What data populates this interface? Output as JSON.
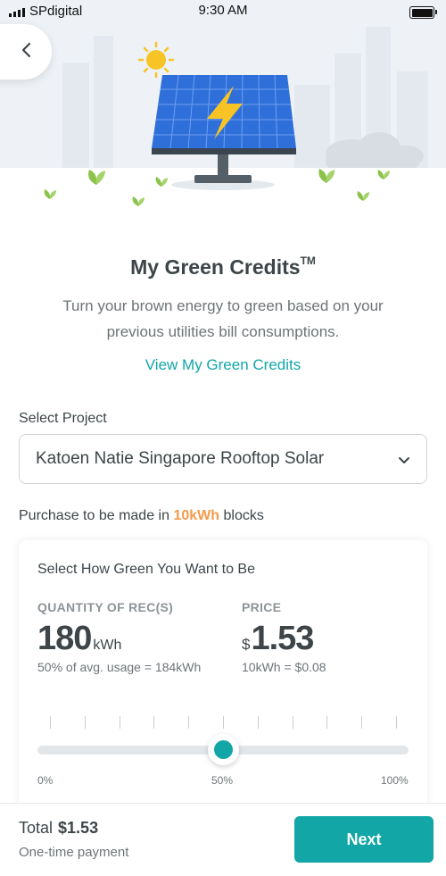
{
  "status_bar": {
    "carrier": "SPdigital",
    "time": "9:30 AM",
    "signal_bars": 4,
    "battery_level": 1.0
  },
  "nav": {
    "back_icon": "chevron-left-icon"
  },
  "hero": {
    "icons": [
      "sun-icon",
      "solar-panel-icon",
      "lightning-bolt-icon",
      "leaf-icon",
      "cloud-icon"
    ]
  },
  "header": {
    "title": "My Green Credits",
    "title_mark": "TM",
    "subtitle": "Turn your brown energy to green based on your previous utilities bill consumptions.",
    "link": "View My Green Credits"
  },
  "project": {
    "label": "Select Project",
    "selected": "Katoen Natie Singapore Rooftop Solar",
    "chevron_icon": "chevron-down-icon"
  },
  "purchase_note": {
    "prefix": "Purchase to be made in",
    "highlight": "10kWh",
    "suffix": "blocks"
  },
  "card": {
    "title": "Select How Green You Want to Be",
    "quantity": {
      "label": "QUANTITY OF REC(S)",
      "value": "180",
      "unit": "kWh",
      "note": "50% of avg. usage = 184kWh"
    },
    "price": {
      "label": "PRICE",
      "currency": "$",
      "value": "1.53",
      "note": "10kWh = $0.08"
    },
    "slider": {
      "value_percent": 50,
      "tick_count": 11,
      "min_label": "0%",
      "mid_label": "50%",
      "max_label": "100%"
    }
  },
  "footer": {
    "total_label": "Total",
    "total_amount": "$1.53",
    "payment_note": "One-time payment",
    "next_label": "Next"
  },
  "colors": {
    "accent": "#12a6a6",
    "highlight": "#f39a4a",
    "text": "#3d4548",
    "panel": "#2f6fd9",
    "sun": "#f7c325",
    "leaf": "#8bc34a"
  }
}
